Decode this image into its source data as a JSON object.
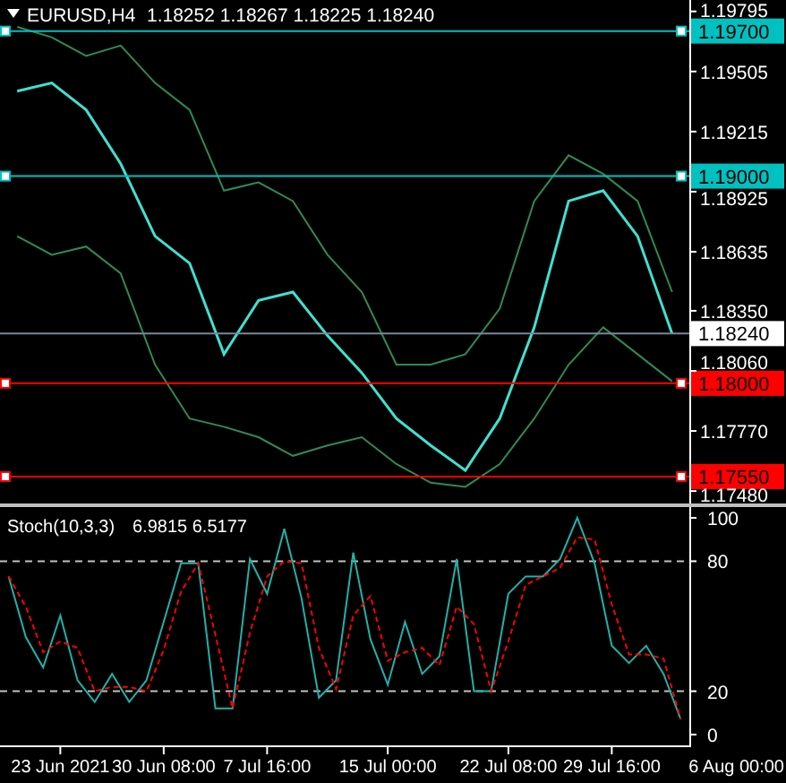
{
  "price_chart": {
    "symbol": "EURUSD,H4",
    "quote": "1.18252 1.18267 1.18225 1.18240",
    "chart_data": {
      "type": "line",
      "categories": [
        null,
        null,
        null,
        null,
        null,
        null,
        null,
        null,
        null,
        null,
        null,
        null,
        null,
        null,
        null,
        null,
        null,
        null,
        null,
        null
      ],
      "ylim": [
        1.1742,
        1.1985
      ],
      "yticks": [
        {
          "value": 1.19795,
          "label": "1.19795"
        },
        {
          "value": 1.19505,
          "label": "1.19505"
        },
        {
          "value": 1.19215,
          "label": "1.19215"
        },
        {
          "value": 1.18925,
          "label": "1.18925"
        },
        {
          "value": 1.18635,
          "label": "1.18635"
        },
        {
          "value": 1.1835,
          "label": "1.18350"
        },
        {
          "value": 1.1806,
          "label": "1.18060"
        },
        {
          "value": 1.1777,
          "label": "1.17770"
        },
        {
          "value": 1.1748,
          "label": "1.17480"
        }
      ],
      "series": [
        {
          "color": "#40e0d0",
          "values": [
            1.1941,
            1.1945,
            1.1932,
            1.1906,
            1.1871,
            1.1858,
            1.1814,
            1.184,
            1.1844,
            1.1823,
            1.1805,
            1.1783,
            1.177,
            1.1758,
            1.1783,
            1.1827,
            1.1888,
            1.1893,
            1.1871,
            1.1824
          ]
        },
        {
          "color": "#2e8b57",
          "values": [
            1.1972,
            1.1967,
            1.1958,
            1.1963,
            1.1945,
            1.1932,
            1.1893,
            1.1897,
            1.1888,
            1.1862,
            1.1844,
            1.1809,
            1.1809,
            1.1814,
            1.1836,
            1.1888,
            1.191,
            1.1901,
            1.1888,
            1.1844
          ]
        },
        {
          "color": "#2e8b57",
          "values": [
            1.1871,
            1.1862,
            1.1866,
            1.1853,
            1.1809,
            1.1783,
            1.1779,
            1.1774,
            1.1765,
            1.177,
            1.1774,
            1.1761,
            1.1752,
            1.175,
            1.1761,
            1.1783,
            1.1809,
            1.1827,
            1.1814,
            1.1801
          ]
        }
      ],
      "ref_lines": [
        {
          "axis": "y",
          "value": 1.197,
          "label": "1.19700",
          "color": "#00c0c0"
        },
        {
          "axis": "y",
          "value": 1.19,
          "label": "1.19000",
          "color": "#00c0c0"
        },
        {
          "axis": "y",
          "value": 1.1824,
          "label": "1.18240",
          "color": "#778899"
        },
        {
          "axis": "y",
          "value": 1.18,
          "label": "1.18000",
          "color": "#ff0000"
        },
        {
          "axis": "y",
          "value": 1.1755,
          "label": "1.17550",
          "color": "#ff0000"
        }
      ]
    }
  },
  "stochastic": {
    "name": "Stoch(10,3,3)",
    "readings": "6.9815 6.5177",
    "axis_end_label": "6 Aug 00:00",
    "chart_data": {
      "type": "line",
      "ylim": [
        -5,
        105
      ],
      "yticks": [
        0,
        20,
        80,
        100
      ],
      "categories": [
        null,
        null,
        null,
        "23 Jun 2021",
        null,
        null,
        null,
        null,
        null,
        "30 Jun 08:00",
        null,
        null,
        null,
        null,
        null,
        "7 Jul 16:00",
        null,
        null,
        null,
        null,
        null,
        null,
        "15 Jul 00:00",
        null,
        null,
        null,
        null,
        null,
        null,
        "22 Jul 08:00",
        null,
        null,
        null,
        null,
        null,
        "29 Jul 16:00",
        null,
        null,
        null,
        null
      ],
      "series": [
        {
          "color": "#20b2aa",
          "values": [
            73,
            45,
            31,
            55,
            25,
            15,
            28,
            15,
            25,
            52,
            79,
            79,
            12,
            12,
            81,
            65,
            95,
            63,
            17,
            25,
            84,
            44,
            23,
            52,
            28,
            36,
            81,
            20,
            20,
            65,
            73,
            73,
            81,
            100,
            79,
            41,
            33,
            41,
            28,
            7
          ]
        },
        {
          "color": "#ff0000",
          "line_style": "dashed",
          "values": [
            73,
            59,
            38,
            43,
            40,
            20,
            22,
            22,
            20,
            39,
            66,
            79,
            46,
            12,
            47,
            73,
            80,
            79,
            40,
            21,
            55,
            64,
            34,
            38,
            40,
            32,
            59,
            51,
            20,
            43,
            69,
            73,
            77,
            91,
            90,
            60,
            37,
            37,
            35,
            7
          ]
        }
      ],
      "ref_lines": [
        {
          "axis": "y",
          "value": 80
        },
        {
          "axis": "y",
          "value": 20
        }
      ]
    }
  }
}
